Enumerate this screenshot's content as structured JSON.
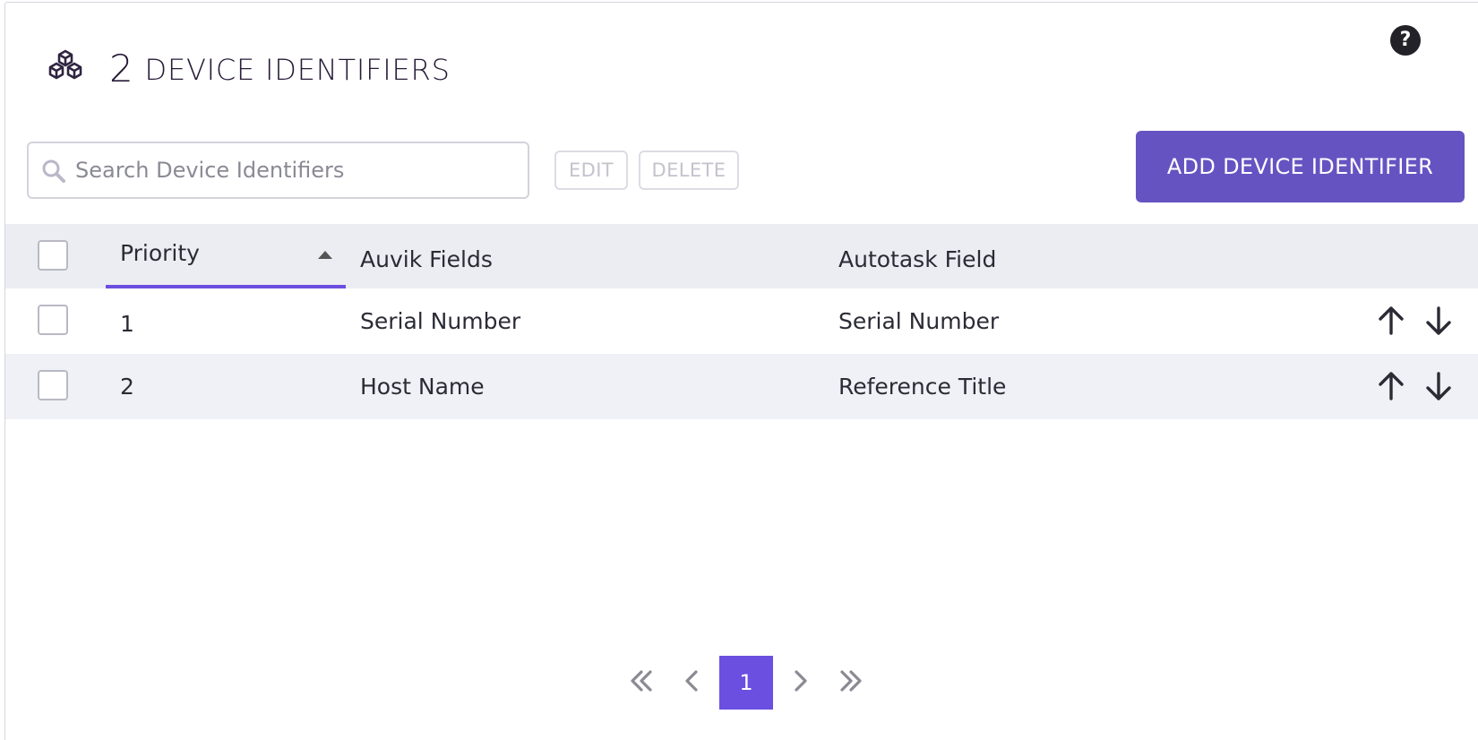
{
  "header": {
    "count": "2",
    "title": "DEVICE IDENTIFIERS",
    "help_label": "?"
  },
  "toolbar": {
    "search_placeholder": "Search Device Identifiers",
    "edit_label": "EDIT",
    "delete_label": "DELETE",
    "add_label": "ADD DEVICE IDENTIFIER"
  },
  "table": {
    "columns": [
      "Priority",
      "Auvik Fields",
      "Autotask Field"
    ],
    "sorted_by": "Priority",
    "sort_direction": "ascending",
    "rows": [
      {
        "priority": "1",
        "auvik_field": "Serial Number",
        "autotask_field": "Serial Number"
      },
      {
        "priority": "2",
        "auvik_field": "Host Name",
        "autotask_field": "Reference Title"
      }
    ]
  },
  "pagination": {
    "current_page": "1"
  },
  "icons": {
    "header": "cubes-icon",
    "help": "question-circle-icon",
    "search": "search-icon",
    "sort": "sort-up-icon",
    "move_up": "arrow-up-icon",
    "move_down": "arrow-down-icon",
    "first": "double-chevron-left-icon",
    "prev": "chevron-left-icon",
    "next": "chevron-right-icon",
    "last": "double-chevron-right-icon"
  },
  "colors": {
    "accent": "#6653c2",
    "sort_indicator": "#6a4fe0",
    "header_bg": "#ecedf3",
    "striped_row_bg": "#f0f1f6"
  }
}
